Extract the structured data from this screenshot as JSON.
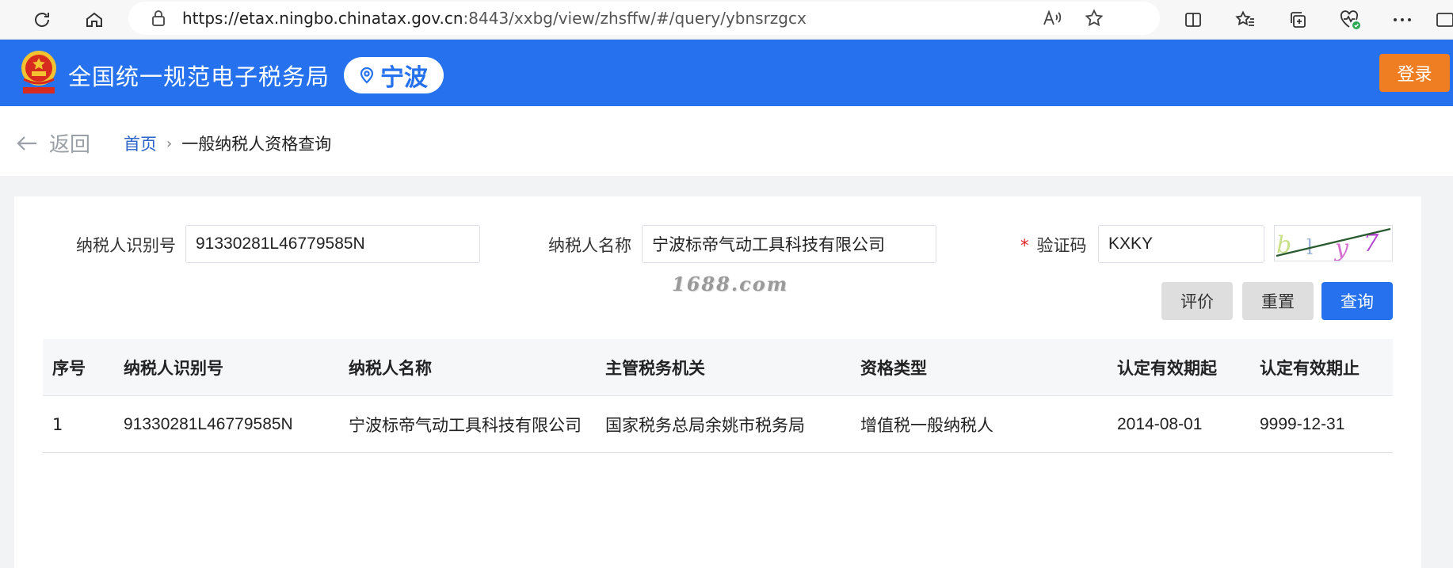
{
  "browser": {
    "url_host": "https://etax.ningbo.chinatax.gov.cn",
    "url_rest": ":8443/xxbg/view/zhsffw/#/query/ybnsrzgcx"
  },
  "header": {
    "title": "全国统一规范电子税务局",
    "city": "宁波",
    "login_label": "登录",
    "emblem_icon": "national-emblem-icon"
  },
  "breadcrumb": {
    "back_label": "返回",
    "home": "首页",
    "current": "一般纳税人资格查询"
  },
  "form": {
    "taxpayer_id_label": "纳税人识别号",
    "taxpayer_id_value": "91330281L46779585N",
    "taxpayer_name_label": "纳税人名称",
    "taxpayer_name_value": "宁波标帝气动工具科技有限公司",
    "captcha_required_mark": "*",
    "captcha_label": "验证码",
    "captcha_value": "KXKY",
    "captcha_image_text": "b l y 7"
  },
  "watermark": "1688.com",
  "buttons": {
    "evaluate": "评价",
    "reset": "重置",
    "query": "查询"
  },
  "table": {
    "columns": [
      "序号",
      "纳税人识别号",
      "纳税人名称",
      "主管税务机关",
      "资格类型",
      "认定有效期起",
      "认定有效期止"
    ],
    "rows": [
      [
        "1",
        "91330281L46779585N",
        "宁波标帝气动工具科技有限公司",
        "国家税务总局余姚市税务局",
        "增值税一般纳税人",
        "2014-08-01",
        "9999-12-31"
      ]
    ]
  },
  "colors": {
    "brand_blue": "#2672ee",
    "login_orange": "#ef7d21"
  }
}
